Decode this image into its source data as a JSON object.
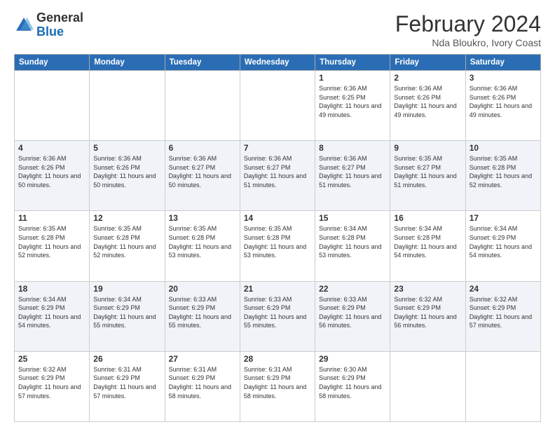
{
  "header": {
    "logo_general": "General",
    "logo_blue": "Blue",
    "month_title": "February 2024",
    "subtitle": "Nda Bloukro, Ivory Coast"
  },
  "weekdays": [
    "Sunday",
    "Monday",
    "Tuesday",
    "Wednesday",
    "Thursday",
    "Friday",
    "Saturday"
  ],
  "weeks": [
    [
      {
        "day": "",
        "info": ""
      },
      {
        "day": "",
        "info": ""
      },
      {
        "day": "",
        "info": ""
      },
      {
        "day": "",
        "info": ""
      },
      {
        "day": "1",
        "info": "Sunrise: 6:36 AM\nSunset: 6:25 PM\nDaylight: 11 hours and 49 minutes."
      },
      {
        "day": "2",
        "info": "Sunrise: 6:36 AM\nSunset: 6:26 PM\nDaylight: 11 hours and 49 minutes."
      },
      {
        "day": "3",
        "info": "Sunrise: 6:36 AM\nSunset: 6:26 PM\nDaylight: 11 hours and 49 minutes."
      }
    ],
    [
      {
        "day": "4",
        "info": "Sunrise: 6:36 AM\nSunset: 6:26 PM\nDaylight: 11 hours and 50 minutes."
      },
      {
        "day": "5",
        "info": "Sunrise: 6:36 AM\nSunset: 6:26 PM\nDaylight: 11 hours and 50 minutes."
      },
      {
        "day": "6",
        "info": "Sunrise: 6:36 AM\nSunset: 6:27 PM\nDaylight: 11 hours and 50 minutes."
      },
      {
        "day": "7",
        "info": "Sunrise: 6:36 AM\nSunset: 6:27 PM\nDaylight: 11 hours and 51 minutes."
      },
      {
        "day": "8",
        "info": "Sunrise: 6:36 AM\nSunset: 6:27 PM\nDaylight: 11 hours and 51 minutes."
      },
      {
        "day": "9",
        "info": "Sunrise: 6:35 AM\nSunset: 6:27 PM\nDaylight: 11 hours and 51 minutes."
      },
      {
        "day": "10",
        "info": "Sunrise: 6:35 AM\nSunset: 6:28 PM\nDaylight: 11 hours and 52 minutes."
      }
    ],
    [
      {
        "day": "11",
        "info": "Sunrise: 6:35 AM\nSunset: 6:28 PM\nDaylight: 11 hours and 52 minutes."
      },
      {
        "day": "12",
        "info": "Sunrise: 6:35 AM\nSunset: 6:28 PM\nDaylight: 11 hours and 52 minutes."
      },
      {
        "day": "13",
        "info": "Sunrise: 6:35 AM\nSunset: 6:28 PM\nDaylight: 11 hours and 53 minutes."
      },
      {
        "day": "14",
        "info": "Sunrise: 6:35 AM\nSunset: 6:28 PM\nDaylight: 11 hours and 53 minutes."
      },
      {
        "day": "15",
        "info": "Sunrise: 6:34 AM\nSunset: 6:28 PM\nDaylight: 11 hours and 53 minutes."
      },
      {
        "day": "16",
        "info": "Sunrise: 6:34 AM\nSunset: 6:28 PM\nDaylight: 11 hours and 54 minutes."
      },
      {
        "day": "17",
        "info": "Sunrise: 6:34 AM\nSunset: 6:29 PM\nDaylight: 11 hours and 54 minutes."
      }
    ],
    [
      {
        "day": "18",
        "info": "Sunrise: 6:34 AM\nSunset: 6:29 PM\nDaylight: 11 hours and 54 minutes."
      },
      {
        "day": "19",
        "info": "Sunrise: 6:34 AM\nSunset: 6:29 PM\nDaylight: 11 hours and 55 minutes."
      },
      {
        "day": "20",
        "info": "Sunrise: 6:33 AM\nSunset: 6:29 PM\nDaylight: 11 hours and 55 minutes."
      },
      {
        "day": "21",
        "info": "Sunrise: 6:33 AM\nSunset: 6:29 PM\nDaylight: 11 hours and 55 minutes."
      },
      {
        "day": "22",
        "info": "Sunrise: 6:33 AM\nSunset: 6:29 PM\nDaylight: 11 hours and 56 minutes."
      },
      {
        "day": "23",
        "info": "Sunrise: 6:32 AM\nSunset: 6:29 PM\nDaylight: 11 hours and 56 minutes."
      },
      {
        "day": "24",
        "info": "Sunrise: 6:32 AM\nSunset: 6:29 PM\nDaylight: 11 hours and 57 minutes."
      }
    ],
    [
      {
        "day": "25",
        "info": "Sunrise: 6:32 AM\nSunset: 6:29 PM\nDaylight: 11 hours and 57 minutes."
      },
      {
        "day": "26",
        "info": "Sunrise: 6:31 AM\nSunset: 6:29 PM\nDaylight: 11 hours and 57 minutes."
      },
      {
        "day": "27",
        "info": "Sunrise: 6:31 AM\nSunset: 6:29 PM\nDaylight: 11 hours and 58 minutes."
      },
      {
        "day": "28",
        "info": "Sunrise: 6:31 AM\nSunset: 6:29 PM\nDaylight: 11 hours and 58 minutes."
      },
      {
        "day": "29",
        "info": "Sunrise: 6:30 AM\nSunset: 6:29 PM\nDaylight: 11 hours and 58 minutes."
      },
      {
        "day": "",
        "info": ""
      },
      {
        "day": "",
        "info": ""
      }
    ]
  ]
}
